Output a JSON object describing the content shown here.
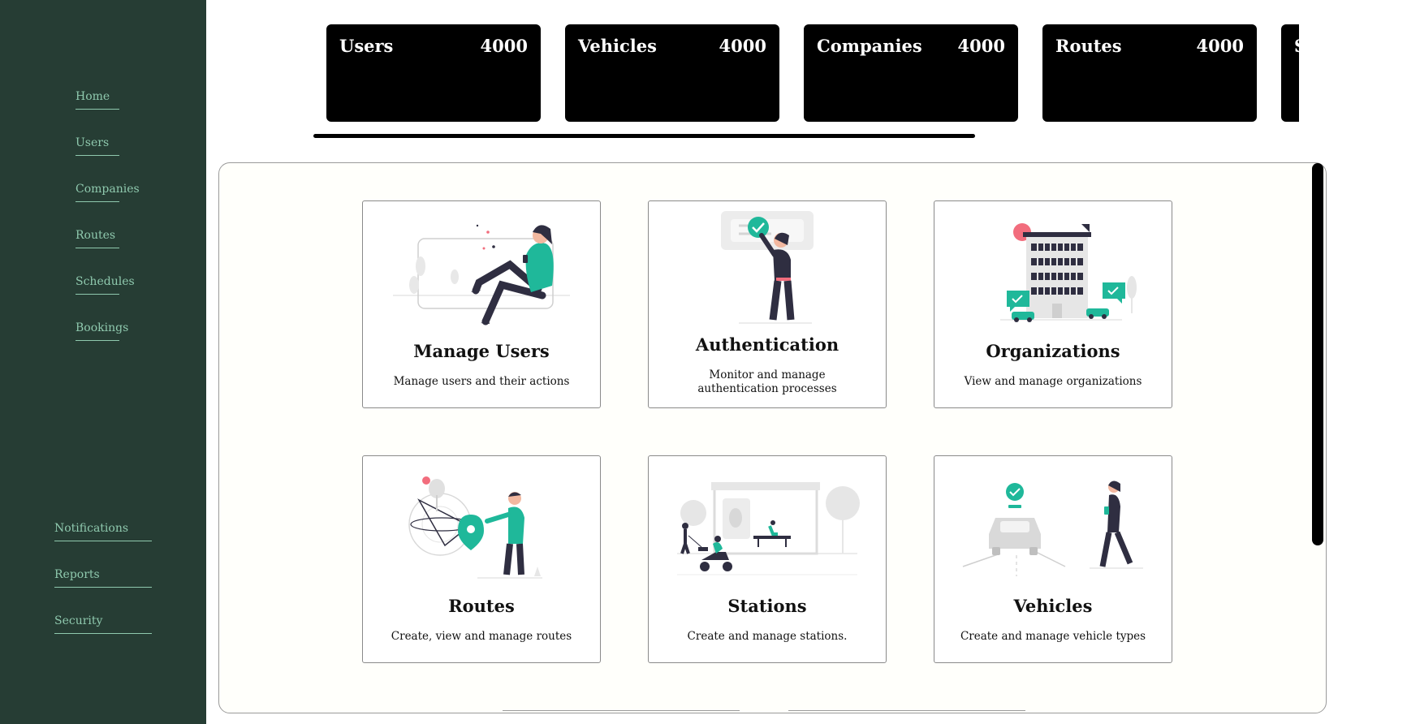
{
  "sidebar": {
    "top_items": [
      {
        "label": "Home"
      },
      {
        "label": "Users"
      },
      {
        "label": "Companies"
      },
      {
        "label": "Routes"
      },
      {
        "label": "Schedules"
      },
      {
        "label": "Bookings"
      }
    ],
    "bottom_items": [
      {
        "label": "Notifications"
      },
      {
        "label": "Reports"
      },
      {
        "label": "Security"
      }
    ]
  },
  "stats": [
    {
      "label": "Users",
      "value": "4000"
    },
    {
      "label": "Vehicles",
      "value": "4000"
    },
    {
      "label": "Companies",
      "value": "4000"
    },
    {
      "label": "Routes",
      "value": "4000"
    },
    {
      "label": "S",
      "value": ""
    }
  ],
  "tiles": [
    {
      "title": "Manage Users",
      "description": "Manage users and their actions",
      "illustration": "person-sitting-phone-illustration"
    },
    {
      "title": "Authentication",
      "description": "Monitor and manage authentication processes",
      "illustration": "person-checkmark-illustration"
    },
    {
      "title": "Organizations",
      "description": "View and manage organizations",
      "illustration": "office-building-illustration"
    },
    {
      "title": "Routes",
      "description": "Create, view and manage routes",
      "illustration": "person-map-pin-illustration"
    },
    {
      "title": "Stations",
      "description": "Create and manage stations.",
      "illustration": "bus-station-illustration"
    },
    {
      "title": "Vehicles",
      "description": "Create and manage vehicle types",
      "illustration": "car-person-illustration"
    }
  ],
  "colors": {
    "sidebar_bg": "#263d34",
    "sidebar_text": "#8fc9ae",
    "accent": "#1fb89a",
    "stat_card_bg": "#000000"
  }
}
